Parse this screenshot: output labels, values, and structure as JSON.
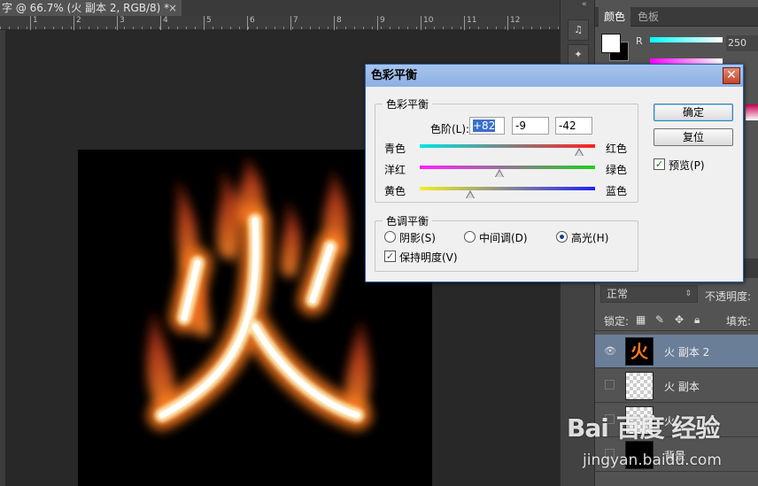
{
  "document": {
    "tab_title": "字 @ 66.7% (火 副本 2, RGB/8) *",
    "close_glyph": "×",
    "ruler_ticks": [
      "1",
      "2",
      "3",
      "4",
      "5",
      "6",
      "7",
      "8",
      "9",
      "10",
      "11",
      "12"
    ]
  },
  "canvas": {
    "character": "火"
  },
  "dock": {
    "collapse_glyph": "«",
    "buttons": [
      "♫",
      "✦",
      "⚙"
    ]
  },
  "color_panel": {
    "tabs": [
      "颜色",
      "色板"
    ],
    "channel_r_label": "R",
    "value_r": "250",
    "fg_color": "#ffffff",
    "bg_color": "#000000"
  },
  "layers_panel": {
    "blend_mode": "正常",
    "opacity_label": "不透明度:",
    "lock_label": "锁定:",
    "fill_label": "填充:",
    "layers": [
      {
        "name": "火 副本 2",
        "selected": true,
        "visible": true
      },
      {
        "name": "火 副本",
        "selected": false,
        "visible": false
      },
      {
        "name": "火",
        "selected": false,
        "visible": false
      },
      {
        "name": "背景",
        "selected": false,
        "visible": false
      }
    ]
  },
  "dialog": {
    "title": "色彩平衡",
    "close_glyph": "✕",
    "group1_title": "色彩平衡",
    "levels_label": "色阶(L):",
    "levels": [
      "+82",
      "-9",
      "-42"
    ],
    "sliders": [
      {
        "left": "青色",
        "right": "红色",
        "value": 82
      },
      {
        "left": "洋红",
        "right": "绿色",
        "value": -9
      },
      {
        "left": "黄色",
        "right": "蓝色",
        "value": -42
      }
    ],
    "group2_title": "色调平衡",
    "tones": [
      {
        "label": "阴影(S)",
        "checked": false
      },
      {
        "label": "中间调(D)",
        "checked": false
      },
      {
        "label": "高光(H)",
        "checked": true
      }
    ],
    "preserve_label": "保持明度(V)",
    "preserve_checked": true,
    "ok_label": "确定",
    "reset_label": "复位",
    "preview_label": "预览(P)",
    "preview_checked": true
  },
  "watermark": {
    "logo": "Bai 百度 经验",
    "url": "jingyan.baidu.com"
  }
}
